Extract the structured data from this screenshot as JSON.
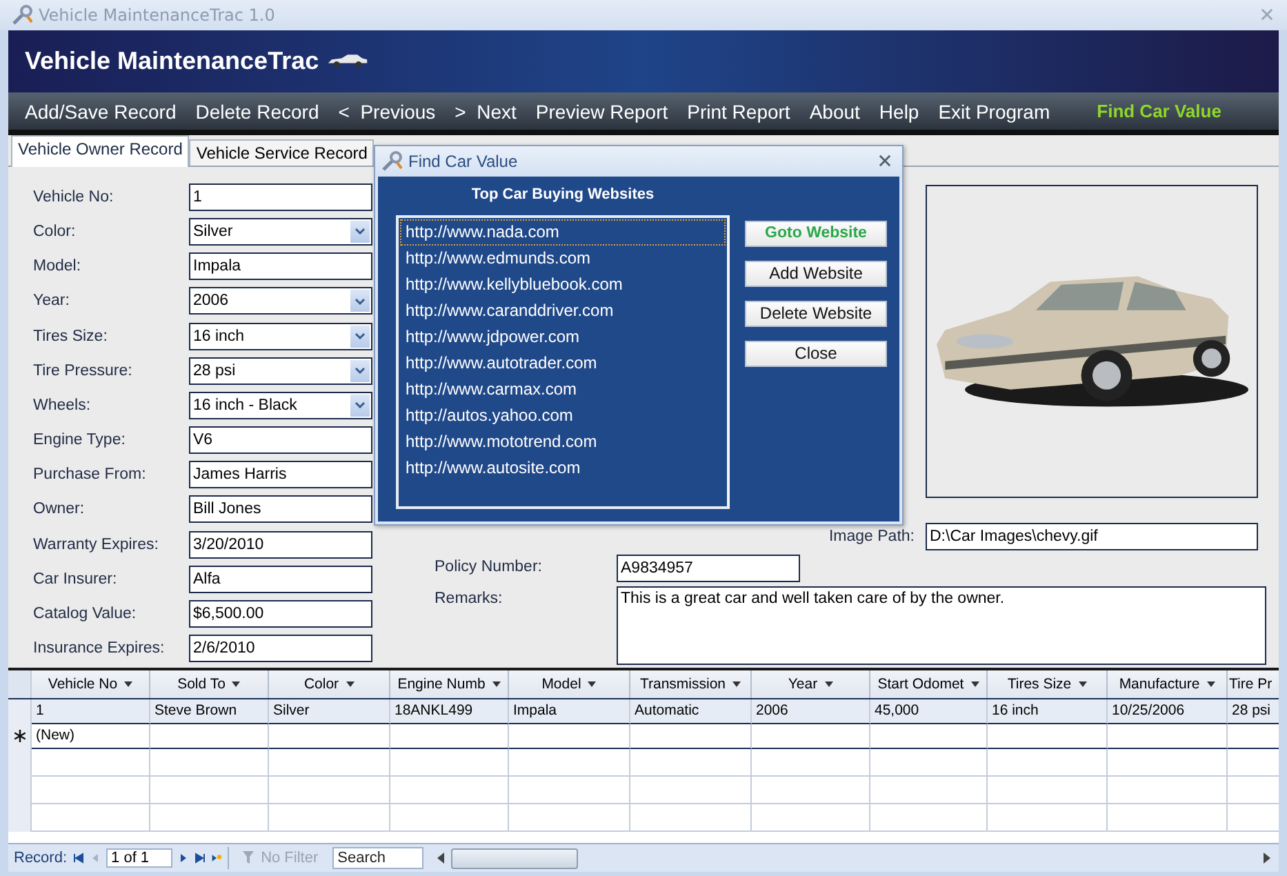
{
  "window": {
    "title": "Vehicle MaintenanceTrac 1.0"
  },
  "banner": {
    "title": "Vehicle MaintenanceTrac"
  },
  "menu": [
    {
      "label": "Add/Save Record",
      "highlighted": false
    },
    {
      "label": "Delete Record",
      "highlighted": false
    },
    {
      "label": "<  Previous",
      "highlighted": false
    },
    {
      "label": ">  Next",
      "highlighted": false
    },
    {
      "label": "Preview Report",
      "highlighted": false
    },
    {
      "label": "Print Report",
      "highlighted": false
    },
    {
      "label": "About",
      "highlighted": false
    },
    {
      "label": "Help",
      "highlighted": false
    },
    {
      "label": "Exit Program",
      "highlighted": false
    },
    {
      "label": "Find Car Value",
      "highlighted": true
    }
  ],
  "tabs": [
    {
      "label": "Vehicle Owner Record",
      "selected": true
    },
    {
      "label": "Vehicle Service Record",
      "selected": false
    }
  ],
  "owner_fields": [
    {
      "label": "Vehicle No:",
      "value": "1",
      "kind": "text"
    },
    {
      "label": "Color:",
      "value": "Silver",
      "kind": "dropdown"
    },
    {
      "label": "Model:",
      "value": "Impala",
      "kind": "text"
    },
    {
      "label": "Year:",
      "value": "2006",
      "kind": "dropdown"
    },
    {
      "label": "Tires Size:",
      "value": "16 inch",
      "kind": "dropdown"
    },
    {
      "label": "Tire Pressure:",
      "value": "28 psi",
      "kind": "dropdown"
    },
    {
      "label": "Wheels:",
      "value": "16 inch - Black",
      "kind": "dropdown"
    },
    {
      "label": "Engine Type:",
      "value": "V6",
      "kind": "text"
    },
    {
      "label": "Purchase From:",
      "value": "James Harris",
      "kind": "text"
    },
    {
      "label": "Owner:",
      "value": "Bill Jones",
      "kind": "text"
    },
    {
      "label": "Warranty Expires:",
      "value": "3/20/2010",
      "kind": "text"
    },
    {
      "label": "Car Insurer:",
      "value": "Alfa",
      "kind": "text"
    },
    {
      "label": "Catalog Value:",
      "value": "$6,500.00",
      "kind": "text"
    },
    {
      "label": "Insurance Expires:",
      "value": "2/6/2010",
      "kind": "text"
    }
  ],
  "image_path": {
    "label": "Image Path:",
    "value": "D:\\Car Images\\chevy.gif"
  },
  "policy": {
    "label": "Policy Number:",
    "value": "A9834957"
  },
  "remarks": {
    "label": "Remarks:",
    "value": "This is a great car and well taken care of by the owner."
  },
  "dialog": {
    "title": "Find Car Value",
    "heading": "Top Car Buying Websites",
    "websites": [
      {
        "url": "http://www.nada.com",
        "selected": true
      },
      {
        "url": "http://www.edmunds.com",
        "selected": false
      },
      {
        "url": "http://www.kellybluebook.com",
        "selected": false
      },
      {
        "url": "http://www.caranddriver.com",
        "selected": false
      },
      {
        "url": "http://www.jdpower.com",
        "selected": false
      },
      {
        "url": "http://www.autotrader.com",
        "selected": false
      },
      {
        "url": "http://www.carmax.com",
        "selected": false
      },
      {
        "url": "http://autos.yahoo.com",
        "selected": false
      },
      {
        "url": "http://www.mototrend.com",
        "selected": false
      },
      {
        "url": "http://www.autosite.com",
        "selected": false
      }
    ],
    "buttons": [
      {
        "label": "Goto Website",
        "highlighted": true
      },
      {
        "label": "Add Website",
        "highlighted": false
      },
      {
        "label": "Delete Website",
        "highlighted": false
      },
      {
        "label": "Close",
        "highlighted": false
      }
    ]
  },
  "table": {
    "columns": [
      "Vehicle No",
      "Sold To",
      "Color",
      "Engine Numb",
      "Model",
      "Transmission",
      "Year",
      "Start Odomet",
      "Tires Size",
      "Manufacture",
      "Tire Pr"
    ],
    "rows": [
      {
        "cells": [
          "1",
          "Steve Brown",
          "Silver",
          "18ANKL499",
          "Impala",
          "Automatic",
          "2006",
          "45,000",
          "16 inch",
          "10/25/2006",
          "28 psi"
        ],
        "selected": true
      }
    ],
    "new_row": {
      "label": "(New)"
    }
  },
  "status_bar": {
    "record_label": "Record:",
    "position": "1 of 1",
    "filter": "No Filter",
    "search_placeholder": "Search"
  }
}
